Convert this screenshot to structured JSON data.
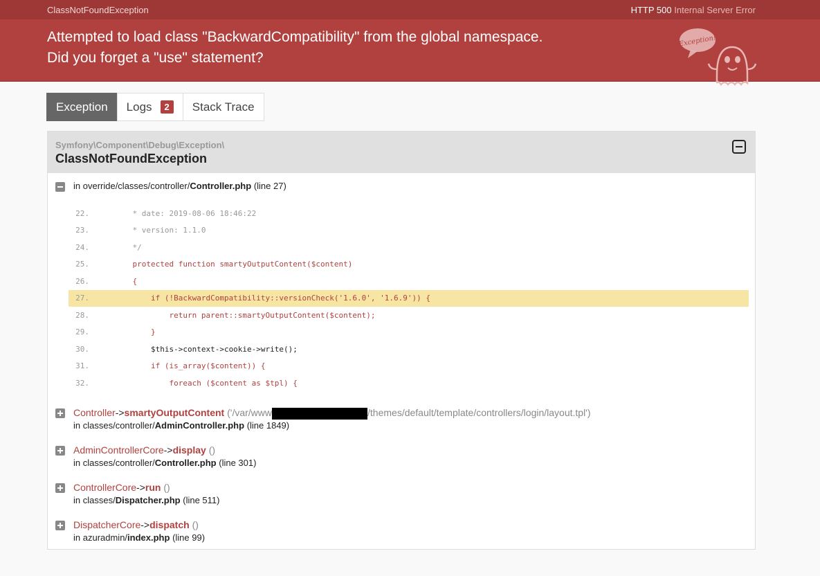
{
  "topbar": {
    "exception_class": "ClassNotFoundException",
    "status_code": "HTTP 500",
    "status_text": "Internal Server Error"
  },
  "header": {
    "line1": "Attempted to load class \"BackwardCompatibility\" from the global namespace.",
    "line2": "Did you forget a \"use\" statement?",
    "logo_text": "Exception!"
  },
  "tabs": [
    {
      "label": "Exception"
    },
    {
      "label": "Logs",
      "badge": "2"
    },
    {
      "label": "Stack Trace"
    }
  ],
  "exception": {
    "namespace": "Symfony\\Component\\Debug\\Exception\\",
    "name": "ClassNotFoundException"
  },
  "source": {
    "prefix": "in override/classes/controller/",
    "file": "Controller.php",
    "line": "(line 27)"
  },
  "code_lines": [
    {
      "num": "22.",
      "text": "    * date: 2019-08-06 18:46:22"
    },
    {
      "num": "23.",
      "text": "    * version: 1.1.0"
    },
    {
      "num": "24.",
      "text": "    */"
    },
    {
      "num": "25.",
      "text": "    protected function smartyOutputContent($content)"
    },
    {
      "num": "26.",
      "text": "    {"
    },
    {
      "num": "27.",
      "text": "        if (!BackwardCompatibility::versionCheck('1.6.0', '1.6.9')) {"
    },
    {
      "num": "28.",
      "text": "            return parent::smartyOutputContent($content);"
    },
    {
      "num": "29.",
      "text": "        }"
    },
    {
      "num": "30.",
      "text": "        $this->context->cookie->write();"
    },
    {
      "num": "31.",
      "text": "        if (is_array($content)) {"
    },
    {
      "num": "32.",
      "text": "            foreach ($content as $tpl) {"
    }
  ],
  "trace": [
    {
      "class": "Controller",
      "arrow": "->",
      "method": "smartyOutputContent",
      "args_before": "('/var/www",
      "args_after": "/themes/default/template/controllers/login/layout.tpl')",
      "loc_prefix": "in classes/controller/",
      "loc_file": "AdminController.php",
      "loc_line": "(line 1849)"
    },
    {
      "class": "AdminControllerCore",
      "arrow": "->",
      "method": "display",
      "args_before": "()",
      "args_after": "",
      "loc_prefix": "in classes/controller/",
      "loc_file": "Controller.php",
      "loc_line": "(line 301)"
    },
    {
      "class": "ControllerCore",
      "arrow": "->",
      "method": "run",
      "args_before": "()",
      "args_after": "",
      "loc_prefix": "in classes/",
      "loc_file": "Dispatcher.php",
      "loc_line": "(line 511)"
    },
    {
      "class": "DispatcherCore",
      "arrow": "->",
      "method": "dispatch",
      "args_before": "()",
      "args_after": "",
      "loc_prefix": "in azuradmin/",
      "loc_file": "index.php",
      "loc_line": "(line 99)"
    }
  ],
  "colors": {
    "header": "#b0413e",
    "topbar": "#9d3837",
    "highlight": "#f7e6a3"
  }
}
